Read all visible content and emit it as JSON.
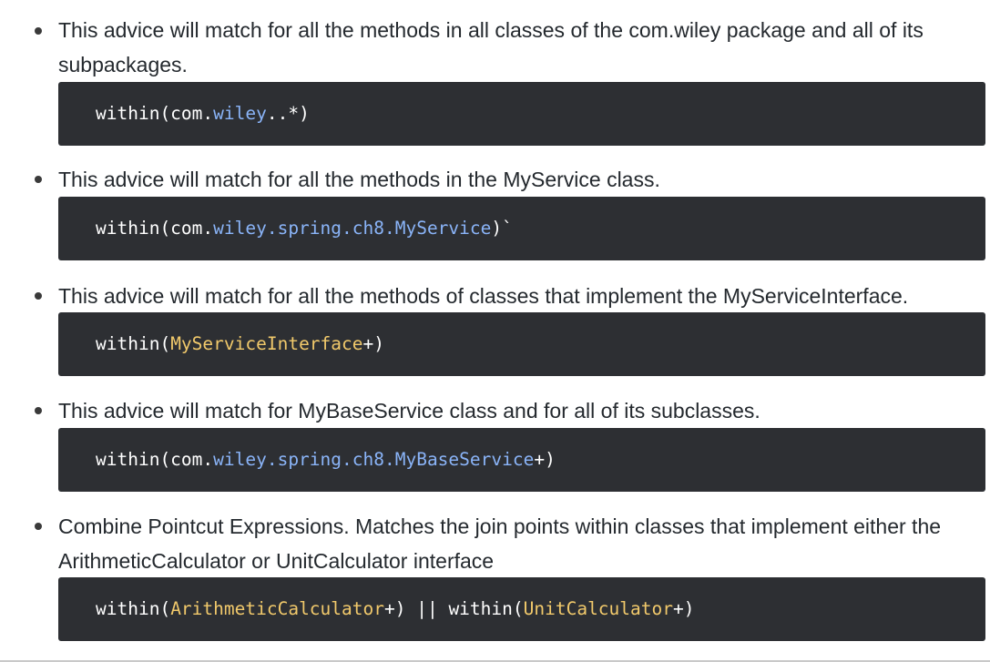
{
  "items": [
    {
      "text": "This advice will match for all the methods in all classes of the com.wiley package and all of its subpackages.",
      "code": [
        {
          "t": "within(com.",
          "c": "plain"
        },
        {
          "t": "wiley",
          "c": "blue"
        },
        {
          "t": "..*)",
          "c": "plain"
        }
      ]
    },
    {
      "text": "This advice will match for all the methods in the MyService class.",
      "code": [
        {
          "t": "within(com.",
          "c": "plain"
        },
        {
          "t": "wiley.spring.ch8.MyService",
          "c": "blue"
        },
        {
          "t": ")`",
          "c": "plain"
        }
      ]
    },
    {
      "text": "This advice will match for all the methods of classes that implement the MyServiceInterface.",
      "code": [
        {
          "t": "within(",
          "c": "plain"
        },
        {
          "t": "MyServiceInterface",
          "c": "yellow"
        },
        {
          "t": "+)",
          "c": "plain"
        }
      ]
    },
    {
      "text": "This advice will match for MyBaseService class and for all of its subclasses.",
      "code": [
        {
          "t": "within(com.",
          "c": "plain"
        },
        {
          "t": "wiley.spring.ch8.MyBaseService",
          "c": "blue"
        },
        {
          "t": "+)",
          "c": "plain"
        }
      ]
    },
    {
      "text": "Combine Pointcut Expressions. Matches the join points within classes that implement either the ArithmeticCalculator or UnitCalculator interface",
      "code": [
        {
          "t": "within(",
          "c": "plain"
        },
        {
          "t": "ArithmeticCalculator",
          "c": "yellow"
        },
        {
          "t": "+) || within(",
          "c": "plain"
        },
        {
          "t": "UnitCalculator",
          "c": "yellow"
        },
        {
          "t": "+)",
          "c": "plain"
        }
      ]
    }
  ],
  "colors": {
    "code_bg": "#2d2f33",
    "token_blue": "#8ab4f8",
    "token_yellow": "#f1c96b",
    "text": "#24292e"
  }
}
